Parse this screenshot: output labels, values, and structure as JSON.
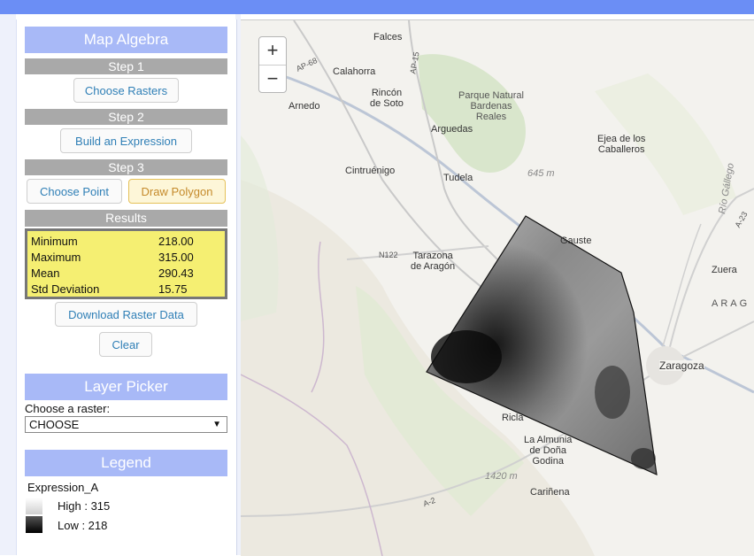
{
  "map_algebra": {
    "title": "Map Algebra",
    "step1": "Step 1",
    "choose_rasters": "Choose Rasters",
    "step2": "Step 2",
    "build_expression": "Build an Expression",
    "step3": "Step 3",
    "choose_point": "Choose Point",
    "draw_polygon": "Draw Polygon",
    "results_title": "Results",
    "results": [
      {
        "label": "Minimum",
        "value": "218.00"
      },
      {
        "label": "Maximum",
        "value": "315.00"
      },
      {
        "label": "Mean",
        "value": "290.43"
      },
      {
        "label": "Std Deviation",
        "value": "15.75"
      }
    ],
    "download": "Download Raster Data",
    "clear": "Clear"
  },
  "layer_picker": {
    "title": "Layer Picker",
    "label": "Choose a raster:",
    "selected": "CHOOSE"
  },
  "legend": {
    "title": "Legend",
    "layer_name": "Expression_A",
    "high": "High : 315",
    "low": "Low : 218"
  },
  "map": {
    "zoom_in": "+",
    "zoom_out": "−",
    "labels": {
      "falces": "Falces",
      "calahorra": "Calahorra",
      "arnedo": "Arnedo",
      "rincon": "Rincón\nde Soto",
      "park": "Parque Natural\nBardenas\nReales",
      "arguedas": "Arguedas",
      "ejea": "Ejea de los\nCaballeros",
      "cintruenigo": "Cintruénigo",
      "tudela": "Tudela",
      "elev645": "645 m",
      "tarazona": "Tarazona\nde Aragón",
      "gauste": "Gauste",
      "zuera": "Zuera",
      "arag": "ARAG",
      "zaragoza": "Zaragoza",
      "ricla": "Ricla",
      "almunia": "La Almunia\nde Doña\nGodina",
      "elev1420": "1420 m",
      "carinena": "Cariñena",
      "rio_gallego": "Río Gállego",
      "n122": "N122",
      "ap68": "AP-68",
      "ap15": "AP-15",
      "a23": "A-23",
      "a2": "A-2"
    }
  }
}
